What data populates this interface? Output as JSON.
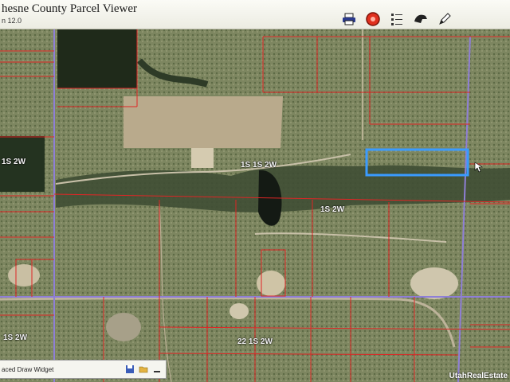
{
  "app": {
    "title": "hesne County Parcel Viewer",
    "subtitle": "n 12.0"
  },
  "toolbar": {
    "icons": [
      "print-icon",
      "record-icon",
      "legend-icon",
      "pan-icon",
      "draw-icon"
    ],
    "record_color": "#e0301e"
  },
  "map": {
    "township_labels": [
      "1S 2W",
      "1S 1S 2W",
      "1S 2W",
      "1S 2W",
      "22 1S 2W"
    ],
    "parcel_line_color": "#e02525",
    "section_line_color": "#8f7fd6",
    "selection_color": "#3a9bff"
  },
  "draw_widget": {
    "title": "aced Draw Widget"
  },
  "watermark": "UtahRealEstate"
}
